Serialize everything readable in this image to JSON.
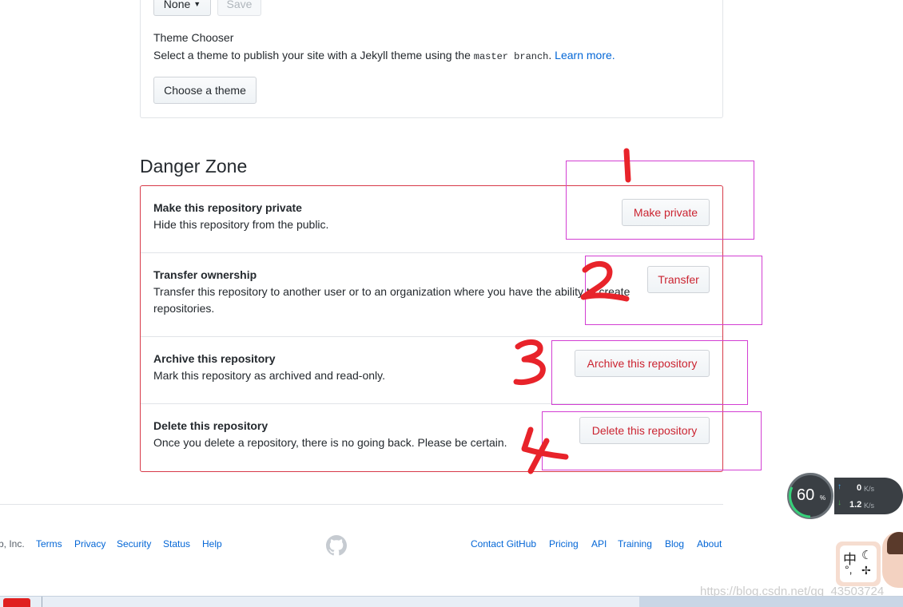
{
  "top_buttons": {
    "branch_select": "None",
    "save": "Save"
  },
  "theme": {
    "heading": "Theme Chooser",
    "desc_prefix": "Select a theme to publish your site with a Jekyll theme using the",
    "desc_code": "master branch",
    "desc_suffix": ".",
    "learn_more": "Learn more.",
    "button": "Choose a theme"
  },
  "danger_zone": {
    "heading": "Danger Zone",
    "rows": [
      {
        "title": "Make this repository private",
        "desc": "Hide this repository from the public.",
        "button": "Make private"
      },
      {
        "title": "Transfer ownership",
        "desc": "Transfer this repository to another user or to an organization where you have the ability to create repositories.",
        "button": "Transfer"
      },
      {
        "title": "Archive this repository",
        "desc": "Mark this repository as archived and read-only.",
        "button": "Archive this repository"
      },
      {
        "title": "Delete this repository",
        "desc": "Once you delete a repository, there is no going back. Please be certain.",
        "button": "Delete this repository"
      }
    ]
  },
  "footer": {
    "left_truncated": "b, Inc.",
    "left_links": [
      "Terms",
      "Privacy",
      "Security",
      "Status",
      "Help"
    ],
    "right_links": [
      "Contact GitHub",
      "Pricing",
      "API",
      "Training",
      "Blog",
      "About"
    ],
    "logo_icon": "github-mark-icon"
  },
  "annotations": [
    "1",
    "2",
    "3",
    "4"
  ],
  "speed_widget": {
    "percent": "60",
    "percent_unit": "%",
    "up": "0",
    "up_unit": "K/s",
    "down": "1.2",
    "down_unit": "K/s"
  },
  "ime": {
    "lang": "中",
    "punct": "°,"
  },
  "watermark": "https://blog.csdn.net/qq_43503724",
  "colors": {
    "danger": "#cb2431",
    "link": "#0366d6",
    "annotation_red": "#e8232a",
    "annotation_box": "#d33fd3"
  }
}
